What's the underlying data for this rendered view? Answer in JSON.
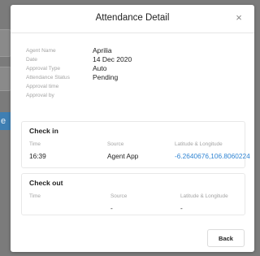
{
  "background": {
    "button_fragment": "e"
  },
  "modal": {
    "title": "Attendance Detail",
    "close_glyph": "×",
    "info": [
      {
        "label": "Agent Name",
        "value": "Aprilia"
      },
      {
        "label": "Date",
        "value": "14 Dec 2020"
      },
      {
        "label": "Approval Type",
        "value": "Auto"
      },
      {
        "label": "Attendance Status",
        "value": "Pending"
      },
      {
        "label": "Approval time",
        "value": ""
      },
      {
        "label": "Approval by",
        "value": ""
      }
    ],
    "check_in": {
      "title": "Check in",
      "headers": {
        "time": "Time",
        "source": "Source",
        "location": "Latitude & Longitude"
      },
      "values": {
        "time": "16:39",
        "source": "Agent App",
        "location": "-6.2640676,106.8060224"
      }
    },
    "check_out": {
      "title": "Check out",
      "headers": {
        "time": "Time",
        "source": "Source",
        "location": "Latitude & Longitude"
      },
      "values": {
        "time": "",
        "source": "-",
        "location": "-"
      }
    },
    "back_label": "Back"
  },
  "colors": {
    "overlay": "#7b7b7b",
    "link": "#2f84d3",
    "bg_button": "#3f7fb3"
  },
  "icons": {
    "close": "close-icon"
  }
}
